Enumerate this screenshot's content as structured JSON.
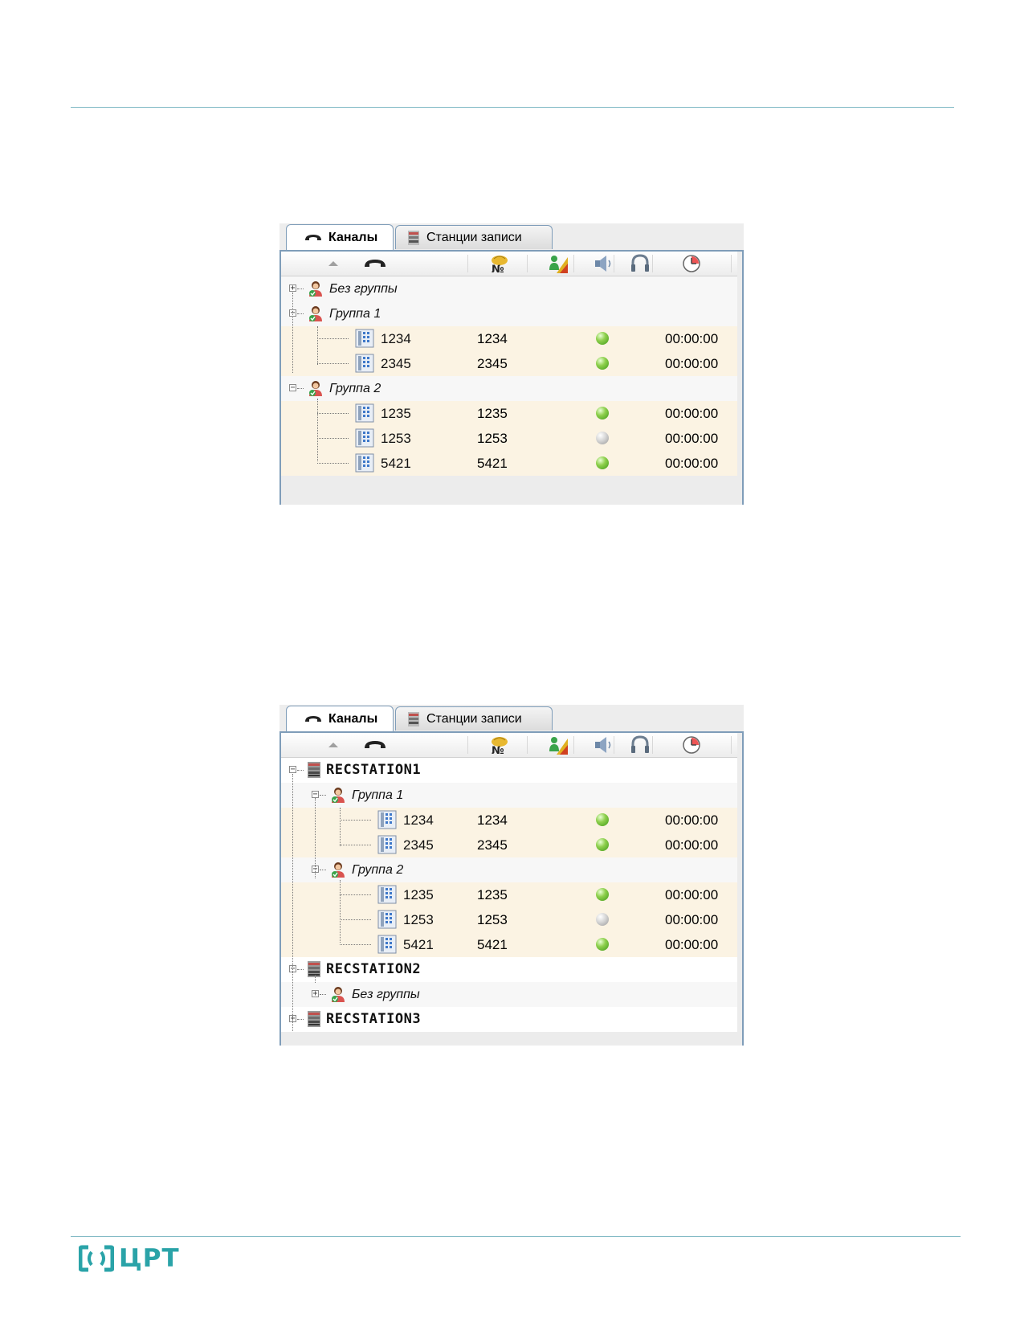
{
  "tabs": {
    "channels": "Каналы",
    "stations": "Станции записи"
  },
  "panel1": {
    "rows": [
      {
        "kind": "group",
        "label": "Без группы"
      },
      {
        "kind": "group",
        "label": "Группа 1"
      },
      {
        "kind": "channel",
        "name": "1234",
        "number": "1234",
        "status": "green",
        "time": "00:00:00"
      },
      {
        "kind": "channel",
        "name": "2345",
        "number": "2345",
        "status": "green",
        "time": "00:00:00"
      },
      {
        "kind": "group",
        "label": "Группа 2"
      },
      {
        "kind": "channel",
        "name": "1235",
        "number": "1235",
        "status": "green",
        "time": "00:00:00"
      },
      {
        "kind": "channel",
        "name": "1253",
        "number": "1253",
        "status": "grey",
        "time": "00:00:00"
      },
      {
        "kind": "channel",
        "name": "5421",
        "number": "5421",
        "status": "green",
        "time": "00:00:00"
      }
    ]
  },
  "panel2": {
    "rows": [
      {
        "kind": "station",
        "label": "RECSTATION1"
      },
      {
        "kind": "group",
        "label": "Группа 1"
      },
      {
        "kind": "channel",
        "name": "1234",
        "number": "1234",
        "status": "green",
        "time": "00:00:00"
      },
      {
        "kind": "channel",
        "name": "2345",
        "number": "2345",
        "status": "green",
        "time": "00:00:00"
      },
      {
        "kind": "group",
        "label": "Группа 2"
      },
      {
        "kind": "channel",
        "name": "1235",
        "number": "1235",
        "status": "green",
        "time": "00:00:00"
      },
      {
        "kind": "channel",
        "name": "1253",
        "number": "1253",
        "status": "grey",
        "time": "00:00:00"
      },
      {
        "kind": "channel",
        "name": "5421",
        "number": "5421",
        "status": "green",
        "time": "00:00:00"
      },
      {
        "kind": "station",
        "label": "RECSTATION2"
      },
      {
        "kind": "group",
        "label": "Без группы"
      },
      {
        "kind": "station",
        "label": "RECSTATION3"
      }
    ]
  },
  "columns_icons": [
    "sort-up-icon",
    "phone-icon",
    "number-icon",
    "person-level-icon",
    "speaker-icon",
    "headphones-icon",
    "clock-icon"
  ],
  "colors": {
    "accent": "#2aa3a8",
    "status_green": "#5cb82c",
    "status_grey": "#c8c8c8",
    "channel_row": "#fbf3e3",
    "border": "#7f9db9"
  },
  "logo": {
    "text": "ЦРТ"
  }
}
